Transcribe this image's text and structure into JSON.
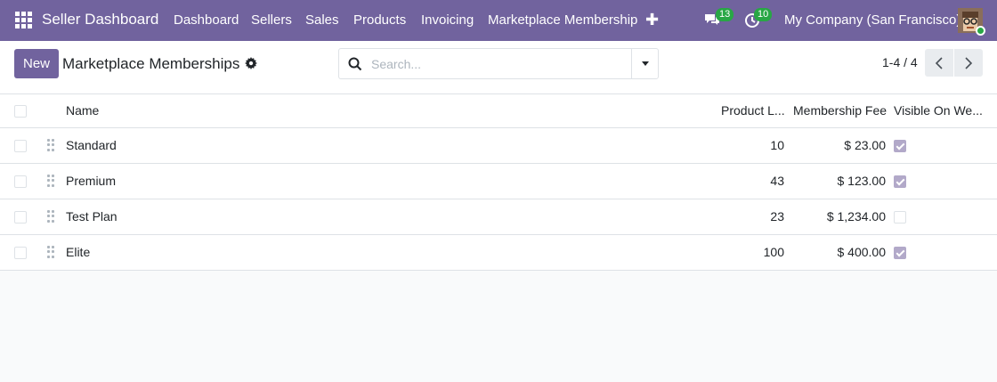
{
  "navbar": {
    "brand": "Seller Dashboard",
    "menu": [
      "Dashboard",
      "Sellers",
      "Sales",
      "Products",
      "Invoicing",
      "Marketplace Membership"
    ],
    "messages_count": "13",
    "activities_count": "10",
    "company": "My Company (San Francisco)"
  },
  "control_panel": {
    "new_label": "New",
    "title": "Marketplace Memberships",
    "search_placeholder": "Search...",
    "pager": "1-4 / 4"
  },
  "table": {
    "headers": {
      "name": "Name",
      "product_limit": "Product L...",
      "membership_fee": "Membership Fee",
      "visible": "Visible On We..."
    },
    "rows": [
      {
        "name": "Standard",
        "product_limit": "10",
        "fee": "$ 23.00",
        "visible": true
      },
      {
        "name": "Premium",
        "product_limit": "43",
        "fee": "$ 123.00",
        "visible": true
      },
      {
        "name": "Test Plan",
        "product_limit": "23",
        "fee": "$ 1,234.00",
        "visible": false
      },
      {
        "name": "Elite",
        "product_limit": "100",
        "fee": "$ 400.00",
        "visible": true
      }
    ]
  },
  "colors": {
    "brand": "#71639e",
    "badge": "#28a745"
  }
}
